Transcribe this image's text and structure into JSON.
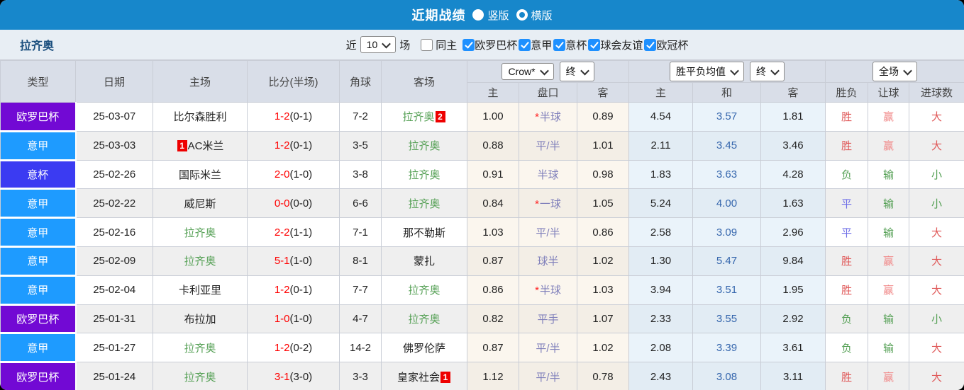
{
  "title_bar": {
    "title": "近期战绩",
    "radios": [
      {
        "label": "竖版",
        "selected": false
      },
      {
        "label": "横版",
        "selected": true
      }
    ]
  },
  "filter_bar": {
    "team": "拉齐奥",
    "near_label": "近",
    "games_value": "10",
    "games_label": "场",
    "same_home": {
      "label": "同主",
      "checked": false
    },
    "competitions": [
      {
        "label": "欧罗巴杯",
        "checked": true
      },
      {
        "label": "意甲",
        "checked": true
      },
      {
        "label": "意杯",
        "checked": true
      },
      {
        "label": "球会友谊",
        "checked": true
      },
      {
        "label": "欧冠杯",
        "checked": true
      }
    ]
  },
  "table": {
    "static_headers": [
      "类型",
      "日期",
      "主场",
      "比分(半场)",
      "角球",
      "客场"
    ],
    "selects": {
      "crow": "Crow*",
      "crow_period": "终",
      "avg": "胜平负均值",
      "avg_period": "终",
      "scope": "全场"
    },
    "sub_headers": [
      "主",
      "盘口",
      "客",
      "主",
      "和",
      "客",
      "胜负",
      "让球",
      "进球数"
    ],
    "rows": [
      {
        "type": "欧罗巴杯",
        "date": "25-03-07",
        "home": {
          "name": "比尔森胜利",
          "lazio": false
        },
        "score_ft": "1-2",
        "score_ht": "(0-1)",
        "corners": "7-2",
        "away": {
          "name": "拉齐奥",
          "lazio": true,
          "badge": "2",
          "badge_pos": "after"
        },
        "crow_home": "1.00",
        "handicap": {
          "star": true,
          "text": "半球"
        },
        "crow_away": "0.89",
        "avg_home": "4.54",
        "avg_draw": "3.57",
        "avg_away": "1.81",
        "outcome": {
          "text": "胜",
          "color": "red"
        },
        "handicap_result": {
          "text": "赢",
          "color": "pink"
        },
        "goals_result": {
          "text": "大",
          "color": "red"
        }
      },
      {
        "type": "意甲",
        "date": "25-03-03",
        "home": {
          "name": "AC米兰",
          "lazio": false,
          "badge": "1",
          "badge_pos": "before"
        },
        "score_ft": "1-2",
        "score_ht": "(0-1)",
        "corners": "3-5",
        "away": {
          "name": "拉齐奥",
          "lazio": true
        },
        "crow_home": "0.88",
        "handicap": {
          "star": false,
          "text": "平/半"
        },
        "crow_away": "1.01",
        "avg_home": "2.11",
        "avg_draw": "3.45",
        "avg_away": "3.46",
        "outcome": {
          "text": "胜",
          "color": "red"
        },
        "handicap_result": {
          "text": "赢",
          "color": "pink"
        },
        "goals_result": {
          "text": "大",
          "color": "red"
        }
      },
      {
        "type": "意杯",
        "date": "25-02-26",
        "home": {
          "name": "国际米兰",
          "lazio": false
        },
        "score_ft": "2-0",
        "score_ht": "(1-0)",
        "corners": "3-8",
        "away": {
          "name": "拉齐奥",
          "lazio": true
        },
        "crow_home": "0.91",
        "handicap": {
          "star": false,
          "text": "半球"
        },
        "crow_away": "0.98",
        "avg_home": "1.83",
        "avg_draw": "3.63",
        "avg_away": "4.28",
        "outcome": {
          "text": "负",
          "color": "green"
        },
        "handicap_result": {
          "text": "输",
          "color": "green"
        },
        "goals_result": {
          "text": "小",
          "color": "green"
        }
      },
      {
        "type": "意甲",
        "date": "25-02-22",
        "home": {
          "name": "威尼斯",
          "lazio": false
        },
        "score_ft": "0-0",
        "score_ht": "(0-0)",
        "corners": "6-6",
        "away": {
          "name": "拉齐奥",
          "lazio": true
        },
        "crow_home": "0.84",
        "handicap": {
          "star": true,
          "text": "一球"
        },
        "crow_away": "1.05",
        "avg_home": "5.24",
        "avg_draw": "4.00",
        "avg_away": "1.63",
        "outcome": {
          "text": "平",
          "color": "blue"
        },
        "handicap_result": {
          "text": "输",
          "color": "green"
        },
        "goals_result": {
          "text": "小",
          "color": "green"
        }
      },
      {
        "type": "意甲",
        "date": "25-02-16",
        "home": {
          "name": "拉齐奥",
          "lazio": true
        },
        "score_ft": "2-2",
        "score_ht": "(1-1)",
        "corners": "7-1",
        "away": {
          "name": "那不勒斯",
          "lazio": false
        },
        "crow_home": "1.03",
        "handicap": {
          "star": false,
          "text": "平/半"
        },
        "crow_away": "0.86",
        "avg_home": "2.58",
        "avg_draw": "3.09",
        "avg_away": "2.96",
        "outcome": {
          "text": "平",
          "color": "blue"
        },
        "handicap_result": {
          "text": "输",
          "color": "green"
        },
        "goals_result": {
          "text": "大",
          "color": "red"
        }
      },
      {
        "type": "意甲",
        "date": "25-02-09",
        "home": {
          "name": "拉齐奥",
          "lazio": true
        },
        "score_ft": "5-1",
        "score_ht": "(1-0)",
        "corners": "8-1",
        "away": {
          "name": "蒙扎",
          "lazio": false
        },
        "crow_home": "0.87",
        "handicap": {
          "star": false,
          "text": "球半"
        },
        "crow_away": "1.02",
        "avg_home": "1.30",
        "avg_draw": "5.47",
        "avg_away": "9.84",
        "outcome": {
          "text": "胜",
          "color": "red"
        },
        "handicap_result": {
          "text": "赢",
          "color": "pink"
        },
        "goals_result": {
          "text": "大",
          "color": "red"
        }
      },
      {
        "type": "意甲",
        "date": "25-02-04",
        "home": {
          "name": "卡利亚里",
          "lazio": false
        },
        "score_ft": "1-2",
        "score_ht": "(0-1)",
        "corners": "7-7",
        "away": {
          "name": "拉齐奥",
          "lazio": true
        },
        "crow_home": "0.86",
        "handicap": {
          "star": true,
          "text": "半球"
        },
        "crow_away": "1.03",
        "avg_home": "3.94",
        "avg_draw": "3.51",
        "avg_away": "1.95",
        "outcome": {
          "text": "胜",
          "color": "red"
        },
        "handicap_result": {
          "text": "赢",
          "color": "pink"
        },
        "goals_result": {
          "text": "大",
          "color": "red"
        }
      },
      {
        "type": "欧罗巴杯",
        "date": "25-01-31",
        "home": {
          "name": "布拉加",
          "lazio": false
        },
        "score_ft": "1-0",
        "score_ht": "(1-0)",
        "corners": "4-7",
        "away": {
          "name": "拉齐奥",
          "lazio": true
        },
        "crow_home": "0.82",
        "handicap": {
          "star": false,
          "text": "平手"
        },
        "crow_away": "1.07",
        "avg_home": "2.33",
        "avg_draw": "3.55",
        "avg_away": "2.92",
        "outcome": {
          "text": "负",
          "color": "green"
        },
        "handicap_result": {
          "text": "输",
          "color": "green"
        },
        "goals_result": {
          "text": "小",
          "color": "green"
        }
      },
      {
        "type": "意甲",
        "date": "25-01-27",
        "home": {
          "name": "拉齐奥",
          "lazio": true
        },
        "score_ft": "1-2",
        "score_ht": "(0-2)",
        "corners": "14-2",
        "away": {
          "name": "佛罗伦萨",
          "lazio": false
        },
        "crow_home": "0.87",
        "handicap": {
          "star": false,
          "text": "平/半"
        },
        "crow_away": "1.02",
        "avg_home": "2.08",
        "avg_draw": "3.39",
        "avg_away": "3.61",
        "outcome": {
          "text": "负",
          "color": "green"
        },
        "handicap_result": {
          "text": "输",
          "color": "green"
        },
        "goals_result": {
          "text": "大",
          "color": "red"
        }
      },
      {
        "type": "欧罗巴杯",
        "date": "25-01-24",
        "home": {
          "name": "拉齐奥",
          "lazio": true
        },
        "score_ft": "3-1",
        "score_ht": "(3-0)",
        "corners": "3-3",
        "away": {
          "name": "皇家社会",
          "lazio": false,
          "badge": "1",
          "badge_pos": "after"
        },
        "crow_home": "1.12",
        "handicap": {
          "star": false,
          "text": "平/半"
        },
        "crow_away": "0.78",
        "avg_home": "2.43",
        "avg_draw": "3.08",
        "avg_away": "3.11",
        "outcome": {
          "text": "胜",
          "color": "red"
        },
        "handicap_result": {
          "text": "赢",
          "color": "pink"
        },
        "goals_result": {
          "text": "大",
          "color": "red"
        }
      }
    ]
  },
  "colors": {
    "title_bar_blue": "#1787cb",
    "checkbox_blue": "#1e90ff",
    "type_colors": {
      "欧罗巴杯": "#7209d4",
      "意甲": "#1e9bff",
      "意杯": "#3b3bf2"
    },
    "result_colors": {
      "red": "#e05a5a",
      "pink": "#f08888",
      "green": "#55a055",
      "blue": "#7070e8"
    },
    "score_red": "#ff0000",
    "lazio_green": "#55a055",
    "draw_odds_blue": "#3566ad",
    "handicap_text": "#8080bb"
  }
}
